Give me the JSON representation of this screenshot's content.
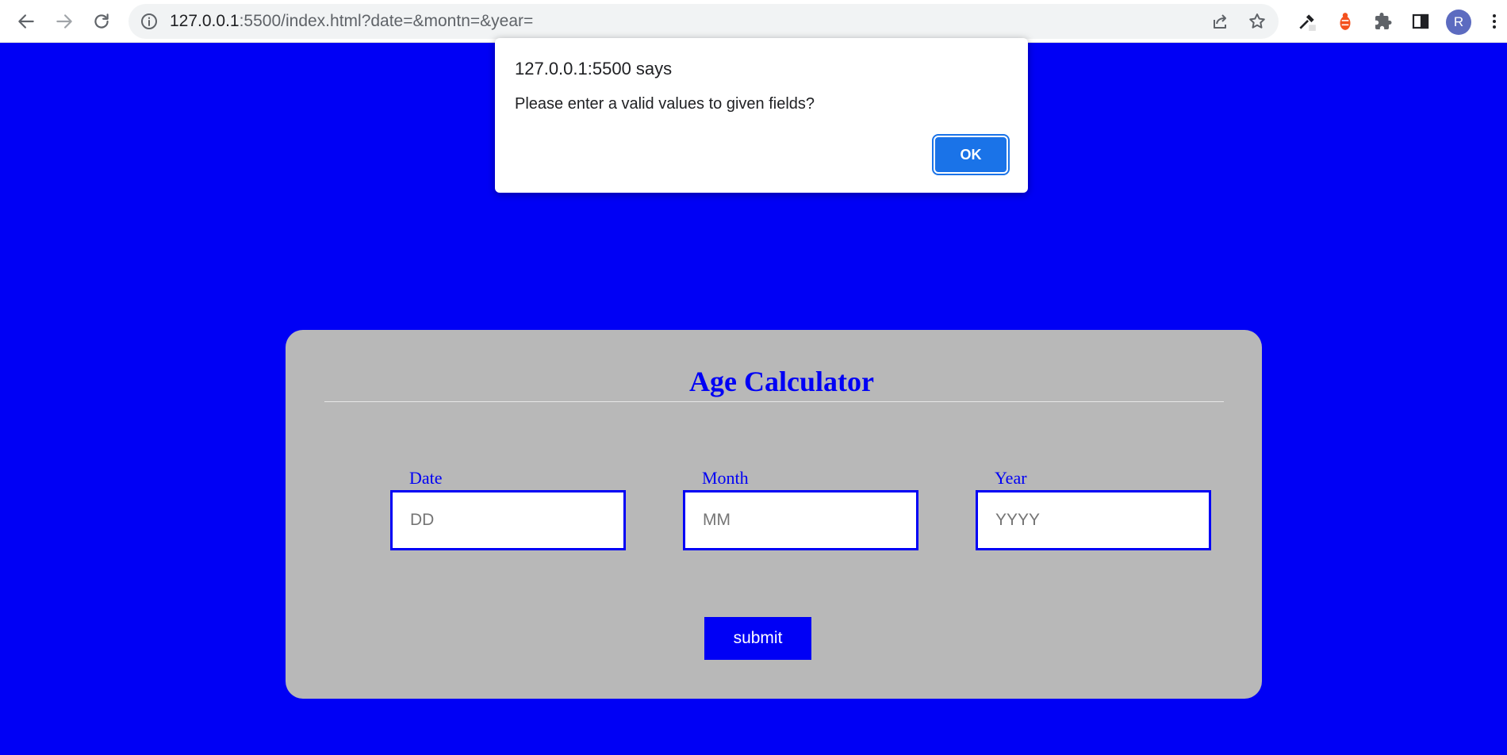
{
  "browser": {
    "url_host": "127.0.0.1",
    "url_path": ":5500/index.html?date=&montn=&year=",
    "profile_initial": "R"
  },
  "app": {
    "title": "Age Calculator",
    "fields": [
      {
        "label": "Date",
        "placeholder": "DD",
        "value": ""
      },
      {
        "label": "Month",
        "placeholder": "MM",
        "value": ""
      },
      {
        "label": "Year",
        "placeholder": "YYYY",
        "value": ""
      }
    ],
    "submit_label": "submit",
    "colors": {
      "page_background": "#0000f5",
      "card_background": "#b8b8b8",
      "accent": "#0000f5"
    }
  },
  "dialog": {
    "title": "127.0.0.1:5500 says",
    "message": "Please enter a valid values to given fields?",
    "ok_label": "OK"
  },
  "icons": [
    "back-arrow-icon",
    "forward-arrow-icon",
    "reload-icon",
    "info-icon",
    "share-icon",
    "bookmark-star-icon",
    "eyedropper-icon",
    "extension-ladybug-icon",
    "puzzle-extensions-icon",
    "side-panel-icon",
    "kebab-menu-icon"
  ]
}
